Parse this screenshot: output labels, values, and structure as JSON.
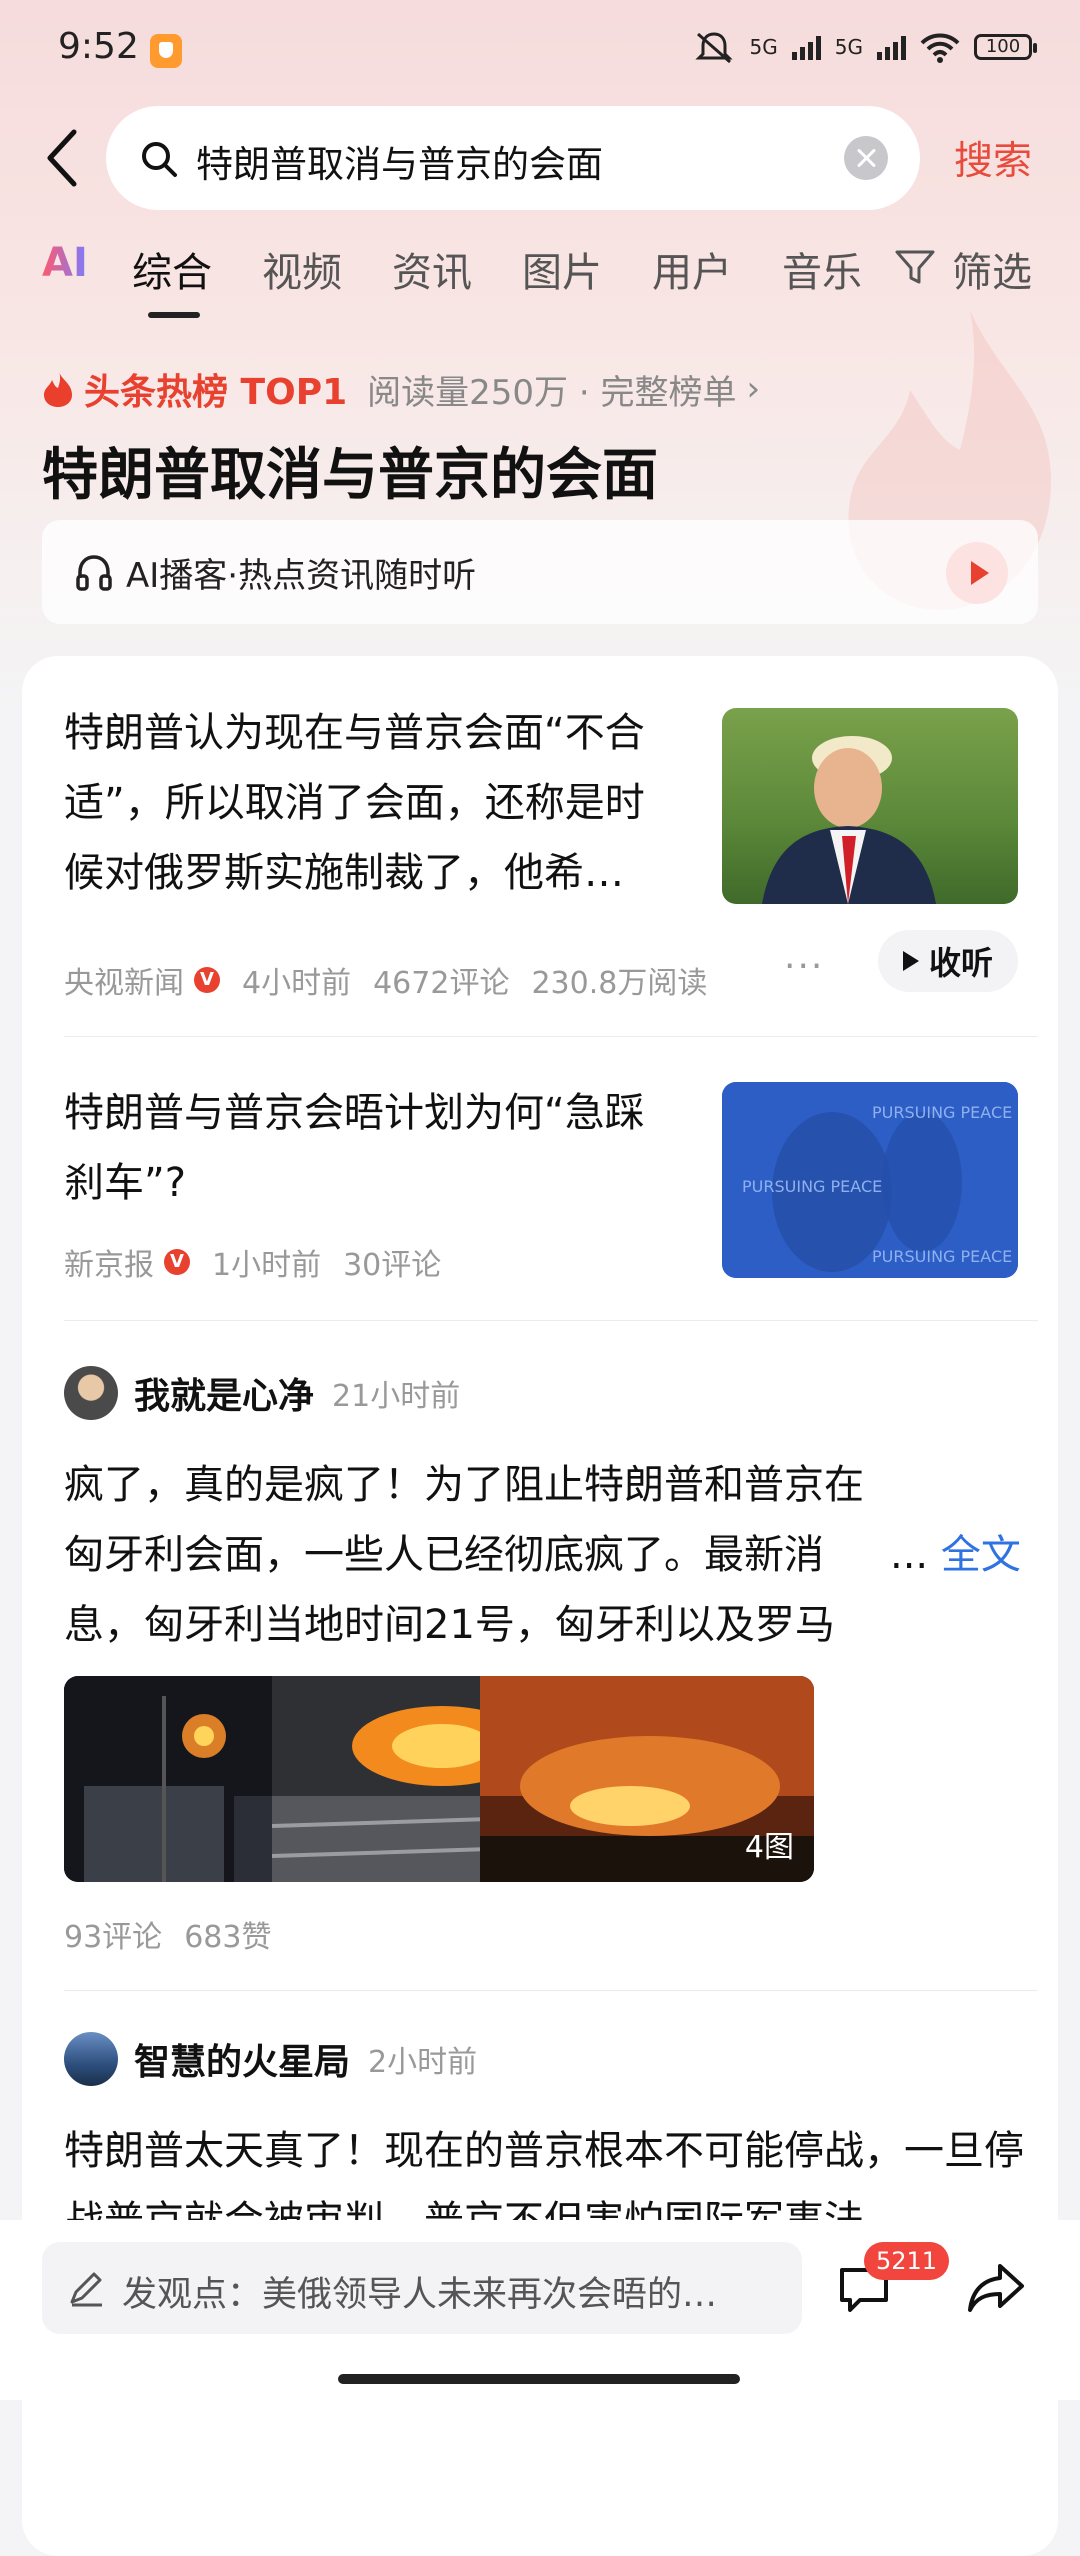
{
  "status_bar": {
    "time": "9:52",
    "network_1": "5G",
    "network_2": "5G",
    "battery": "100"
  },
  "search": {
    "query": "特朗普取消与普京的会面",
    "button": "搜索"
  },
  "tabs": [
    {
      "label": "AI"
    },
    {
      "label": "综合"
    },
    {
      "label": "视频"
    },
    {
      "label": "资讯"
    },
    {
      "label": "图片"
    },
    {
      "label": "用户"
    },
    {
      "label": "音乐"
    },
    {
      "label": "筛选"
    }
  ],
  "hot": {
    "label": "头条热榜 TOP1",
    "meta": "阅读量250万 · 完整榜单",
    "chevron": "›",
    "headline": "特朗普取消与普京的会面",
    "podcast": "AI播客·热点资讯随时听"
  },
  "news": [
    {
      "title": "特朗普认为现在与普京会面“不合适”，所以取消了会面，还称是时候对俄罗斯实施制裁了，他希…",
      "source": "央视新闻",
      "verified": "V",
      "time": "4小时前",
      "comments": "4672评论",
      "reads": "230.8万阅读",
      "more": "···",
      "listen": "收听"
    },
    {
      "title": "特朗普与普京会晤计划为何“急踩刹车”?",
      "source": "新京报",
      "verified": "V",
      "time": "1小时前",
      "comments": "30评论",
      "image_text": "PURSUING PEACE"
    }
  ],
  "posts": [
    {
      "author": "我就是心净",
      "time": "21小时前",
      "body": "疯了，真的是疯了！为了阻止特朗普和普京在匈牙利会面，一些人已经彻底疯了。最新消息，匈牙利当地时间21号，匈牙利以及罗马尼亚境内两",
      "ellipsis": "...",
      "full": "全文",
      "image_count": "4图",
      "comments": "93评论",
      "likes": "683赞"
    },
    {
      "author": "智慧的火星局",
      "time": "2小时前",
      "body": "特朗普太天真了！现在的普京根本不可能停战，一旦停战普京就会被审判，普京不但害怕国际军事法"
    }
  ],
  "bottom": {
    "placeholder": "发观点：美俄领导人未来再次会晤的…",
    "comment_count": "5211"
  },
  "colors": {
    "accent": "#e84a3b",
    "link": "#2f73e0"
  },
  "icons": [
    "back-icon",
    "search-icon",
    "clear-icon",
    "filter-icon",
    "fire-icon",
    "headphone-icon",
    "play-icon",
    "chat-icon",
    "share-icon",
    "pen-icon"
  ]
}
